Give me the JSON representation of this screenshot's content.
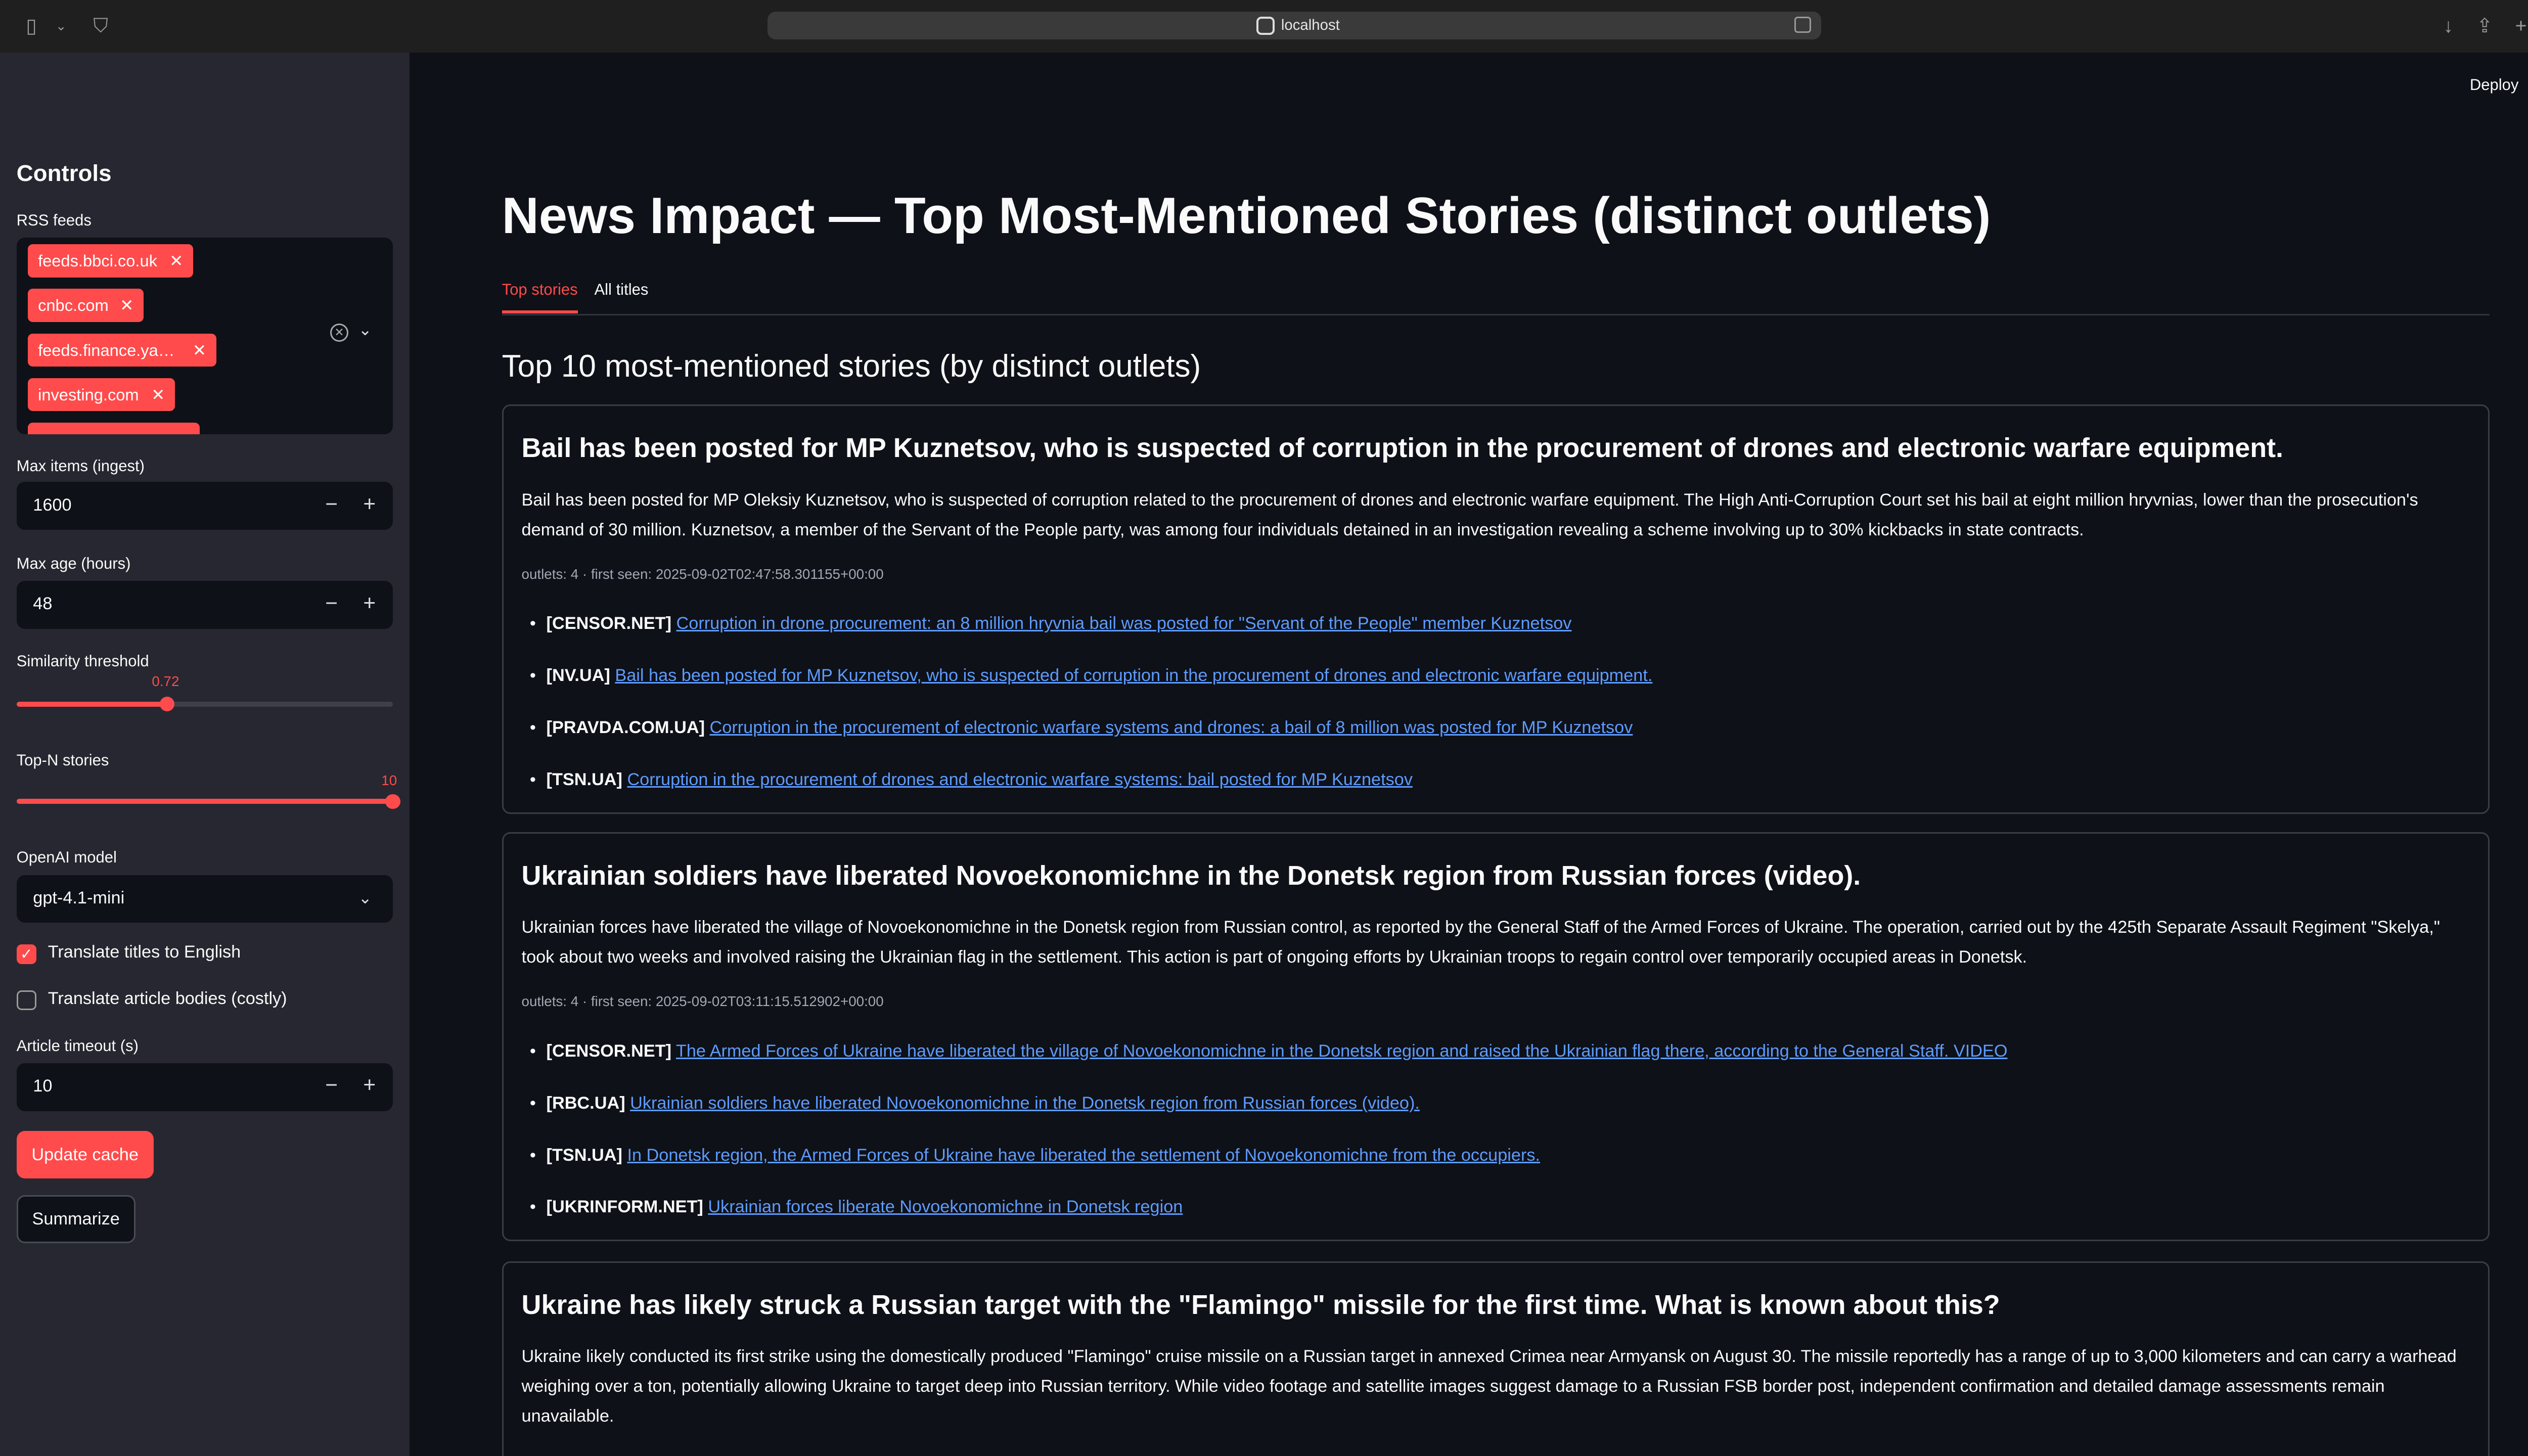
{
  "browser": {
    "url": "localhost"
  },
  "header": {
    "deploy_label": "Deploy"
  },
  "sidebar": {
    "title": "Controls",
    "rss_label": "RSS feeds",
    "feeds": [
      "feeds.bbci.co.uk",
      "cnbc.com",
      "feeds.finance.ya…",
      "investing.com",
      "…"
    ],
    "max_items_label": "Max items (ingest)",
    "max_items_value": "1600",
    "max_age_label": "Max age (hours)",
    "max_age_value": "48",
    "similarity_label": "Similarity threshold",
    "similarity_value": "0.72",
    "similarity_fraction": 0.4,
    "topn_label": "Top-N stories",
    "topn_value": "10",
    "topn_fraction": 1.0,
    "model_label": "OpenAI model",
    "model_value": "gpt-4.1-mini",
    "translate_titles_label": "Translate titles to English",
    "translate_titles_checked": true,
    "translate_bodies_label": "Translate article bodies (costly)",
    "translate_bodies_checked": false,
    "timeout_label": "Article timeout (s)",
    "timeout_value": "10",
    "update_button": "Update cache",
    "summarize_button": "Summarize"
  },
  "main": {
    "title": "News Impact — Top Most-Mentioned Stories (distinct outlets)",
    "tabs": [
      {
        "label": "Top stories",
        "active": true
      },
      {
        "label": "All titles",
        "active": false
      }
    ],
    "heading": "Top 10 most-mentioned stories (by distinct outlets)",
    "stories": [
      {
        "title": "Bail has been posted for MP Kuznetsov, who is suspected of corruption in the procurement of drones and electronic warfare equipment.",
        "summary": "Bail has been posted for MP Oleksiy Kuznetsov, who is suspected of corruption related to the procurement of drones and electronic warfare equipment. The High Anti-Corruption Court set his bail at eight million hryvnias, lower than the prosecution's demand of 30 million. Kuznetsov, a member of the Servant of the People party, was among four individuals detained in an investigation revealing a scheme involving up to 30% kickbacks in state contracts.",
        "meta": "outlets: 4 · first seen: 2025-09-02T02:47:58.301155+00:00",
        "links": [
          {
            "source": "[CENSOR.NET]",
            "text": "Corruption in drone procurement: an 8 million hryvnia bail was posted for \"Servant of the People\" member Kuznetsov"
          },
          {
            "source": "[NV.UA]",
            "text": "Bail has been posted for MP Kuznetsov, who is suspected of corruption in the procurement of drones and electronic warfare equipment."
          },
          {
            "source": "[PRAVDA.COM.UA]",
            "text": "Corruption in the procurement of electronic warfare systems and drones: a bail of 8 million was posted for MP Kuznetsov"
          },
          {
            "source": "[TSN.UA]",
            "text": "Corruption in the procurement of drones and electronic warfare systems: bail posted for MP Kuznetsov"
          }
        ]
      },
      {
        "title": "Ukrainian soldiers have liberated Novoekonomichne in the Donetsk region from Russian forces (video).",
        "summary": "Ukrainian forces have liberated the village of Novoekonomichne in the Donetsk region from Russian control, as reported by the General Staff of the Armed Forces of Ukraine. The operation, carried out by the 425th Separate Assault Regiment \"Skelya,\" took about two weeks and involved raising the Ukrainian flag in the settlement. This action is part of ongoing efforts by Ukrainian troops to regain control over temporarily occupied areas in Donetsk.",
        "meta": "outlets: 4 · first seen: 2025-09-02T03:11:15.512902+00:00",
        "links": [
          {
            "source": "[CENSOR.NET]",
            "text": "The Armed Forces of Ukraine have liberated the village of Novoekonomichne in the Donetsk region and raised the Ukrainian flag there, according to the General Staff. VIDEO"
          },
          {
            "source": "[RBC.UA]",
            "text": "Ukrainian soldiers have liberated Novoekonomichne in the Donetsk region from Russian forces (video)."
          },
          {
            "source": "[TSN.UA]",
            "text": "In Donetsk region, the Armed Forces of Ukraine have liberated the settlement of Novoekonomichne from the occupiers."
          },
          {
            "source": "[UKRINFORM.NET]",
            "text": "Ukrainian forces liberate Novoekonomichne in Donetsk region"
          }
        ]
      },
      {
        "title": "Ukraine has likely struck a Russian target with the \"Flamingo\" missile for the first time. What is known about this?",
        "summary": "Ukraine likely conducted its first strike using the domestically produced \"Flamingo\" cruise missile on a Russian target in annexed Crimea near Armyansk on August 30. The missile reportedly has a range of up to 3,000 kilometers and can carry a warhead weighing over a ton, potentially allowing Ukraine to target deep into Russian territory. While video footage and satellite images suggest damage to a Russian FSB border post, independent confirmation and detailed damage assessments remain unavailable.",
        "meta": "",
        "links": []
      }
    ]
  }
}
